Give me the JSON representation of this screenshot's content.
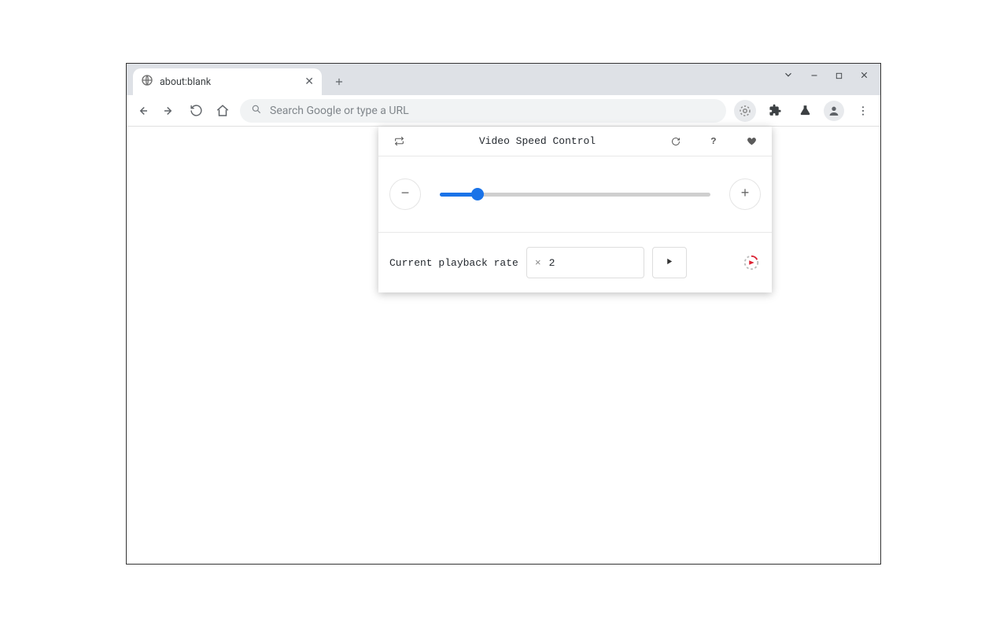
{
  "tab": {
    "title": "about:blank"
  },
  "omnibox": {
    "placeholder": "Search Google or type a URL"
  },
  "popup": {
    "title": "Video Speed Control",
    "minus": "−",
    "plus": "+",
    "rate_label": "Current playback rate",
    "rate_prefix": "×",
    "rate_value": "2"
  }
}
